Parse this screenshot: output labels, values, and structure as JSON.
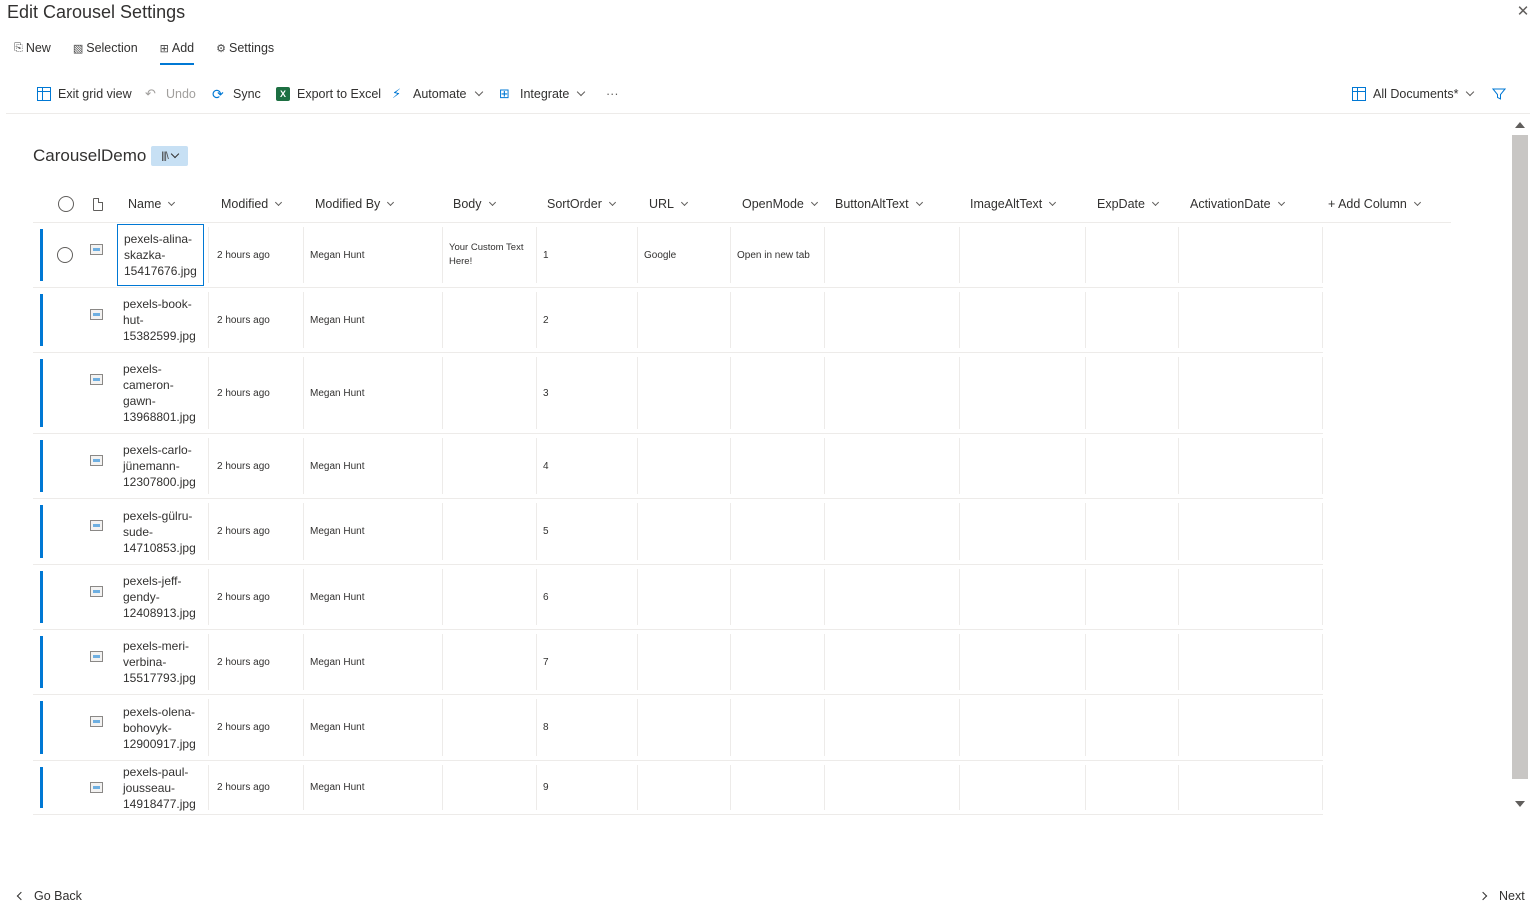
{
  "window": {
    "title": "Edit Carousel Settings",
    "close_icon": "✕"
  },
  "tabs": [
    {
      "label": "New",
      "icon": "new-icon"
    },
    {
      "label": "Selection",
      "icon": "selection-icon"
    },
    {
      "label": "Add",
      "icon": "add-icon",
      "active": true
    },
    {
      "label": "Settings",
      "icon": "gear-icon"
    }
  ],
  "commandbar": {
    "exit_grid": "Exit grid view",
    "undo": "Undo",
    "sync": "Sync",
    "export": "Export to Excel",
    "automate": "Automate",
    "integrate": "Integrate",
    "more": "···",
    "view": "All Documents*"
  },
  "library": {
    "title": "CarouselDemo"
  },
  "columns": [
    "Name",
    "Modified",
    "Modified By",
    "Body",
    "SortOrder",
    "URL",
    "OpenMode",
    "ButtonAltText",
    "ImageAltText",
    "ExpDate",
    "ActivationDate",
    "+ Add Column"
  ],
  "rows": [
    {
      "name": [
        "pexels-alina-",
        "skazka-",
        "15417676.jpg"
      ],
      "modified": "2 hours ago",
      "modified_by": "Megan Hunt",
      "body": [
        "Your Custom Text",
        "Here!"
      ],
      "sort": "1",
      "url": "Google",
      "open_mode": "Open in new tab"
    },
    {
      "name": [
        "pexels-book-",
        "hut-",
        "15382599.jpg"
      ],
      "modified": "2 hours ago",
      "modified_by": "Megan Hunt",
      "body": [],
      "sort": "2",
      "url": "",
      "open_mode": ""
    },
    {
      "name": [
        "pexels-",
        "cameron-",
        "gawn-",
        "13968801.jpg"
      ],
      "modified": "2 hours ago",
      "modified_by": "Megan Hunt",
      "body": [],
      "sort": "3",
      "url": "",
      "open_mode": ""
    },
    {
      "name": [
        "pexels-carlo-",
        "jünemann-",
        "12307800.jpg"
      ],
      "modified": "2 hours ago",
      "modified_by": "Megan Hunt",
      "body": [],
      "sort": "4",
      "url": "",
      "open_mode": ""
    },
    {
      "name": [
        "pexels-gülru-",
        "sude-",
        "14710853.jpg"
      ],
      "modified": "2 hours ago",
      "modified_by": "Megan Hunt",
      "body": [],
      "sort": "5",
      "url": "",
      "open_mode": ""
    },
    {
      "name": [
        "pexels-jeff-",
        "gendy-",
        "12408913.jpg"
      ],
      "modified": "2 hours ago",
      "modified_by": "Megan Hunt",
      "body": [],
      "sort": "6",
      "url": "",
      "open_mode": ""
    },
    {
      "name": [
        "pexels-meri-",
        "verbina-",
        "15517793.jpg"
      ],
      "modified": "2 hours ago",
      "modified_by": "Megan Hunt",
      "body": [],
      "sort": "7",
      "url": "",
      "open_mode": ""
    },
    {
      "name": [
        "pexels-olena-",
        "bohovyk-",
        "12900917.jpg"
      ],
      "modified": "2 hours ago",
      "modified_by": "Megan Hunt",
      "body": [],
      "sort": "8",
      "url": "",
      "open_mode": ""
    },
    {
      "name": [
        "pexels-paul-",
        "jousseau-",
        "14918477.jpg"
      ],
      "modified": "2 hours ago",
      "modified_by": "Megan Hunt",
      "body": [],
      "sort": "9",
      "url": "",
      "open_mode": ""
    }
  ],
  "footer": {
    "back": "Go Back",
    "next": "Next"
  },
  "colors": {
    "accent": "#0078d4",
    "link": "#5c2d91",
    "excel": "#1d6f42"
  }
}
